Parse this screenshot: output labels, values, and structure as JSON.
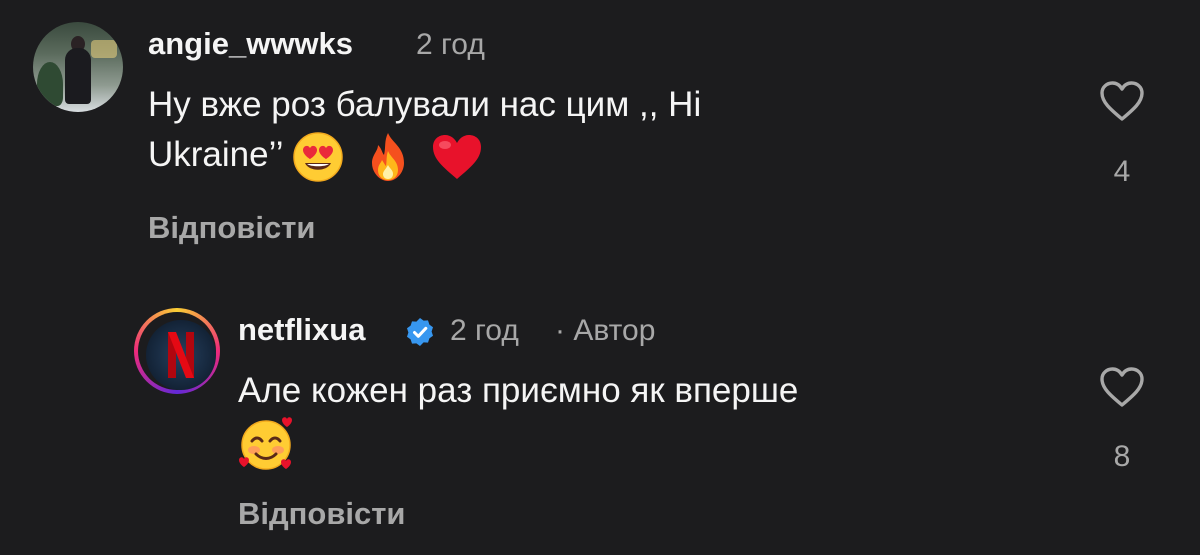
{
  "comments": [
    {
      "username": "angie_wwwks",
      "time": "2 год",
      "text_line1": "Ну вже роз балували нас цим ,, Hi",
      "text_line2": "Ukraine’’",
      "emojis": [
        "heart-eyes-emoji",
        "fire-emoji",
        "red-heart-emoji"
      ],
      "reply_label": "Відповісти",
      "likes": "4"
    },
    {
      "username": "netflixua",
      "verified": true,
      "time": "2 год",
      "author_badge": "· Автор",
      "text_line1": "Але кожен раз приємно як вперше",
      "emojis": [
        "smiling-face-with-hearts-emoji"
      ],
      "reply_label": "Відповісти",
      "likes": "8"
    }
  ],
  "colors": {
    "background": "#1c1c1e",
    "primary_text": "#f5f5f5",
    "secondary_text": "#a8a8a8",
    "verified_blue": "#3797f0"
  }
}
